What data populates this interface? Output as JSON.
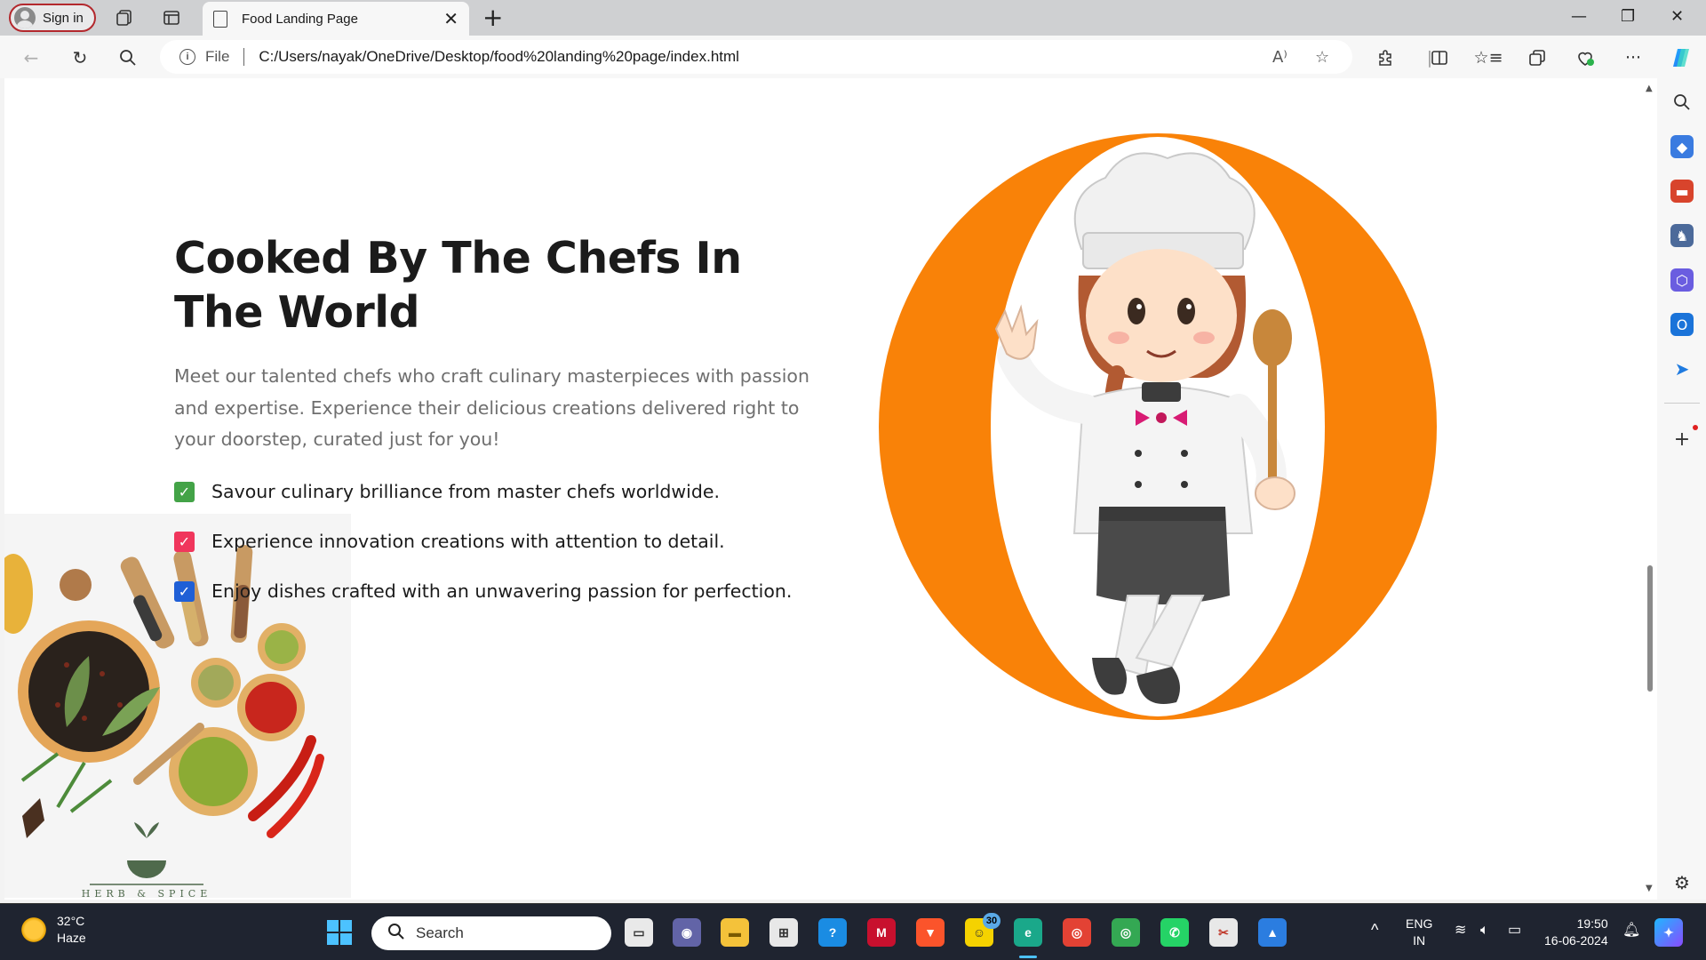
{
  "browser": {
    "signin_label": "Sign in",
    "tab_title": "Food Landing Page",
    "new_tab": "+",
    "window_controls": {
      "minimize": "—",
      "restore": "❐",
      "close": "✕"
    },
    "address": {
      "protocol_label": "File",
      "url": "C:/Users/nayak/OneDrive/Desktop/food%20landing%20page/index.html"
    }
  },
  "page": {
    "title": "Cooked By The Chefs In The World",
    "description": "Meet our talented chefs who craft culinary masterpieces with passion and expertise. Experience their delicious creations delivered right to your doorstep, curated just for you!",
    "features": [
      {
        "text": "Savour culinary brilliance from master chefs worldwide.",
        "color": "#43a347"
      },
      {
        "text": "Experience innovation creations with attention to detail.",
        "color": "#f0365c"
      },
      {
        "text": "Enjoy dishes crafted with an unwavering passion for perfection.",
        "color": "#1f5fd6"
      }
    ],
    "spice_logo_text": "HERB & SPICE",
    "accent_color": "#f98208"
  },
  "taskbar": {
    "weather_temp": "32°C",
    "weather_desc": "Haze",
    "search_placeholder": "Search",
    "badge_count": "30",
    "lang_top": "ENG",
    "lang_bottom": "IN",
    "time": "19:50",
    "date": "16-06-2024"
  }
}
